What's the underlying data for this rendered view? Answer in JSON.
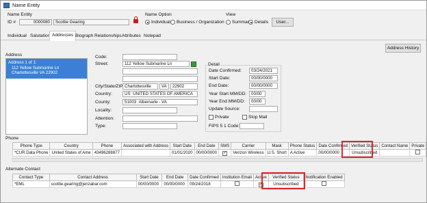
{
  "window": {
    "title": "Name Entity"
  },
  "header": {
    "name_entity_label": "Name Entity",
    "id_label": "ID #",
    "id_value": "0000080",
    "name_value": "Scottie Gearing",
    "name_option_label": "Name Option",
    "name_options": [
      "Individual",
      "Business / Organization"
    ],
    "name_option_selected": "Individual",
    "view_label": "View",
    "view_options": [
      "Summary",
      "Details"
    ],
    "view_selected": "Details",
    "user_button": "User..."
  },
  "tabs": [
    "Individual",
    "Salutations",
    "Addresses",
    "Biograph",
    "Relationships",
    "Attributes",
    "Notepad"
  ],
  "active_tab": "Addresses",
  "address_history_button": "Address History",
  "address": {
    "label": "Address",
    "list_header": "Address 1 of 1:",
    "list_line1": "112 Yellow Submarine Ln",
    "list_line2": "Charlottesville  VA  22902",
    "code_label": "Code:",
    "code_value": "",
    "street_label": "Street:",
    "street_value": "112 Yellow Submarine Ln",
    "city_label": "City/State/ZIP:",
    "city_value": "Charlottesville",
    "state_value": "VA",
    "zip_value": "22902",
    "country_label": "Country:",
    "country_code": "US",
    "country_name": "UNITED STATES OF AMERICA",
    "county_label": "County:",
    "county_code": "51003",
    "county_name": "Albemarle - VA",
    "locality_label": "Locality:",
    "attention_label": "Attention:",
    "type_label": "Type:"
  },
  "detail": {
    "label": "Detail",
    "date_confirmed_label": "Date Confirmed:",
    "date_confirmed": "03/24/2021",
    "start_date_label": "Start Date:",
    "start_date": "00/00/0000",
    "end_date_label": "End Date:",
    "end_date": "00/00/0000",
    "year_start_label": "Year Start MM/DD:",
    "year_start": "00/00",
    "year_end_label": "Year End MM/DD:",
    "year_end": "00/00",
    "update_source_label": "Update Source:",
    "private_label": "Private",
    "stop_mail_label": "Stop Mail",
    "fips_label": "FIPS 5 1 Code:"
  },
  "phone": {
    "label": "Phone",
    "columns": [
      "Phone Type",
      "Country",
      "Phone",
      "Associated with Address",
      "Start Date",
      "End Date",
      "SMS",
      "Carrier",
      "Mask",
      "Phone Status",
      "Date Confirmed",
      "Verified Status",
      "Contact Name",
      "Private"
    ],
    "rows": [
      [
        "*CUR Data Phone",
        "United States of Ame",
        "43496288877",
        "",
        "01/01/2020",
        "00/00/0000",
        "✓",
        "Verizon Wireless",
        "U.S. Short",
        "A  Active",
        "00/00/0000",
        "Unsubscribed",
        "",
        ""
      ]
    ]
  },
  "alternate": {
    "label": "Alternate Contact",
    "columns": [
      "Contact Type",
      "Contact Address",
      "Start Date",
      "End Date",
      "Date Confirmed",
      "Institution Email",
      "Active",
      "Verified Status",
      "Notification Enabled"
    ],
    "rows": [
      [
        "*EML",
        "scottie.gearing@jenzabar.com",
        "00/00/0000",
        "00/00/0000",
        "09/24/2018",
        "",
        "✓",
        "Unsubscribed",
        ""
      ]
    ]
  }
}
